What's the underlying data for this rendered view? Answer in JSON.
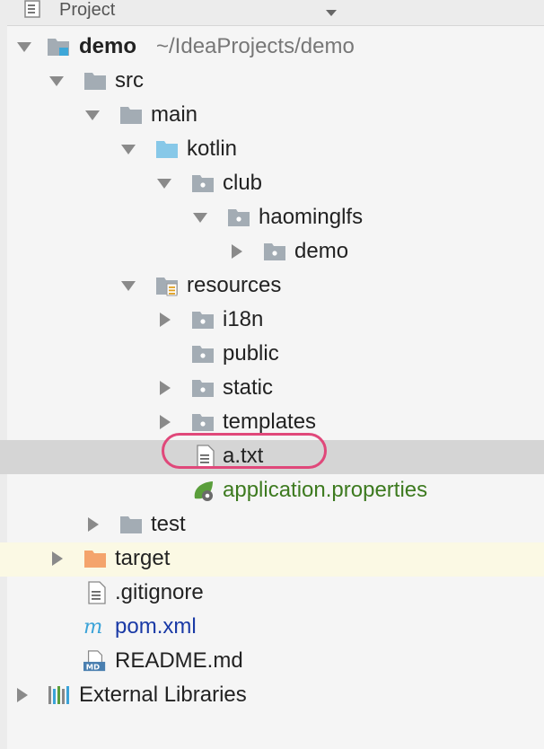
{
  "header": {
    "title": "Project",
    "icon": "project-view-icon",
    "dropdown_icon": "dropdown-caret-icon"
  },
  "tree": {
    "root": {
      "label": "demo",
      "path": "~/IdeaProjects/demo"
    },
    "src": "src",
    "main": "main",
    "kotlin": "kotlin",
    "club": "club",
    "haominglfs": "haominglfs",
    "demo_pkg": "demo",
    "resources": "resources",
    "i18n": "i18n",
    "public": "public",
    "static": "static",
    "templates": "templates",
    "a_txt": "a.txt",
    "application_properties": "application.properties",
    "test": "test",
    "target": "target",
    "gitignore": ".gitignore",
    "pom": "pom.xml",
    "readme": "README.md",
    "external": "External Libraries"
  },
  "colors": {
    "folder": "#a3acb4",
    "source_folder": "#87c8e8",
    "target_folder": "#f4a46c",
    "highlight_ring": "#e0487a",
    "spring_green": "#5a9e3b"
  }
}
